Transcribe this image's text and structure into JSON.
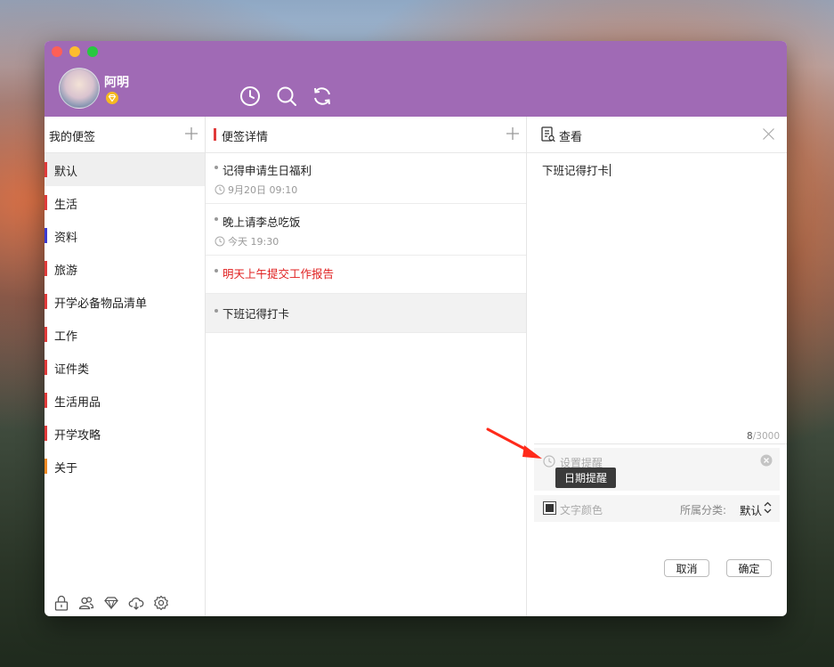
{
  "header": {
    "username": "阿明"
  },
  "categories_panel": {
    "title": "我的便签",
    "items": [
      {
        "label": "默认",
        "color": "#e03a3a",
        "active": true
      },
      {
        "label": "生活",
        "color": "#e03a3a"
      },
      {
        "label": "资料",
        "color": "#3b3bd1"
      },
      {
        "label": "旅游",
        "color": "#e03a3a"
      },
      {
        "label": "开学必备物品清单",
        "color": "#e03a3a"
      },
      {
        "label": "工作",
        "color": "#e03a3a"
      },
      {
        "label": "证件类",
        "color": "#e03a3a"
      },
      {
        "label": "生活用品",
        "color": "#e03a3a"
      },
      {
        "label": "开学攻略",
        "color": "#e03a3a"
      },
      {
        "label": "关于",
        "color": "#f08a24"
      }
    ]
  },
  "notes_panel": {
    "title": "便签详情",
    "notes": [
      {
        "title": "记得申请生日福利",
        "time": "9月20日 09:10"
      },
      {
        "title": "晚上请李总吃饭",
        "time": "今天 19:30"
      },
      {
        "title": "明天上午提交工作报告",
        "important": true
      },
      {
        "title": "下班记得打卡",
        "selected": true
      }
    ]
  },
  "view_panel": {
    "title": "查看",
    "content": "下班记得打卡",
    "char_count": "8",
    "char_max": "/3000",
    "reminder_placeholder": "设置提醒",
    "reminder_tooltip": "日期提醒",
    "text_color_label": "文字颜色",
    "category_label": "所属分类:",
    "category_value": "默认",
    "cancel_label": "取消",
    "ok_label": "确定"
  },
  "colors": {
    "titlebar": "#a06ab5",
    "important_note": "#e02020",
    "accent_bar": "#e03a3a"
  }
}
